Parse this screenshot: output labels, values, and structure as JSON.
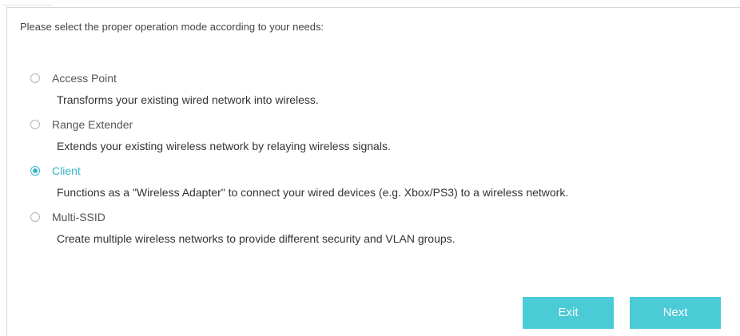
{
  "instruction": "Please select the proper operation mode according to your needs:",
  "modes": [
    {
      "label": "Access Point",
      "description": "Transforms your existing wired network into wireless.",
      "selected": false
    },
    {
      "label": "Range Extender",
      "description": "Extends your existing wireless network by relaying wireless signals.",
      "selected": false
    },
    {
      "label": "Client",
      "description": "Functions as a \"Wireless Adapter\" to connect your wired devices (e.g. Xbox/PS3) to a wireless network.",
      "selected": true
    },
    {
      "label": "Multi-SSID",
      "description": "Create multiple wireless networks to provide different security and VLAN groups.",
      "selected": false
    }
  ],
  "buttons": {
    "exit_label": "Exit",
    "next_label": "Next"
  },
  "colors": {
    "accent": "#39b4c8",
    "button": "#4acbd6"
  }
}
